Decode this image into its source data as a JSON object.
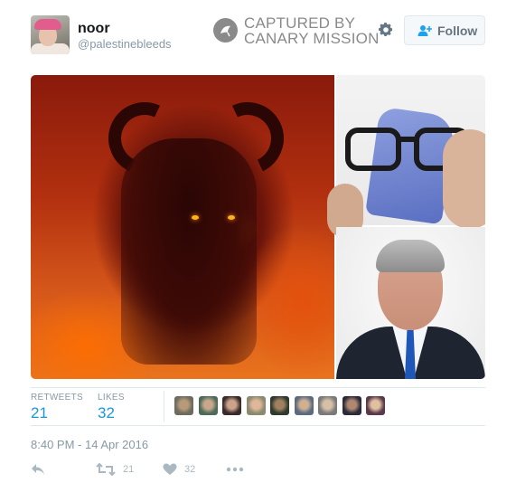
{
  "user": {
    "name": "noor",
    "handle": "@palestinebleeds"
  },
  "watermark": {
    "line1": "CAPTURED BY",
    "line2": "CANARY MISSION",
    "color": "#8a8a8a"
  },
  "header": {
    "follow_label": "Follow",
    "settings_icon": "gear-icon"
  },
  "media": [
    {
      "subject": "red demon figure"
    },
    {
      "subject": "hands cleaning eyeglasses with blue cloth"
    },
    {
      "subject": "man in dark suit and blue tie"
    }
  ],
  "stats": {
    "retweets_label": "RETWEETS",
    "retweets_value": "21",
    "likes_label": "LIKES",
    "likes_value": "32",
    "liker_avatar_count": 9
  },
  "timestamp": "8:40 PM - 14 Apr 2016",
  "actions": {
    "reply_icon": "reply-icon",
    "retweet_icon": "retweet-icon",
    "retweet_count": "21",
    "like_icon": "heart-icon",
    "like_count": "32",
    "more_icon": "more-icon"
  },
  "colors": {
    "link": "#1b95e0",
    "muted": "#8899a6",
    "border": "#e1e8ed"
  }
}
